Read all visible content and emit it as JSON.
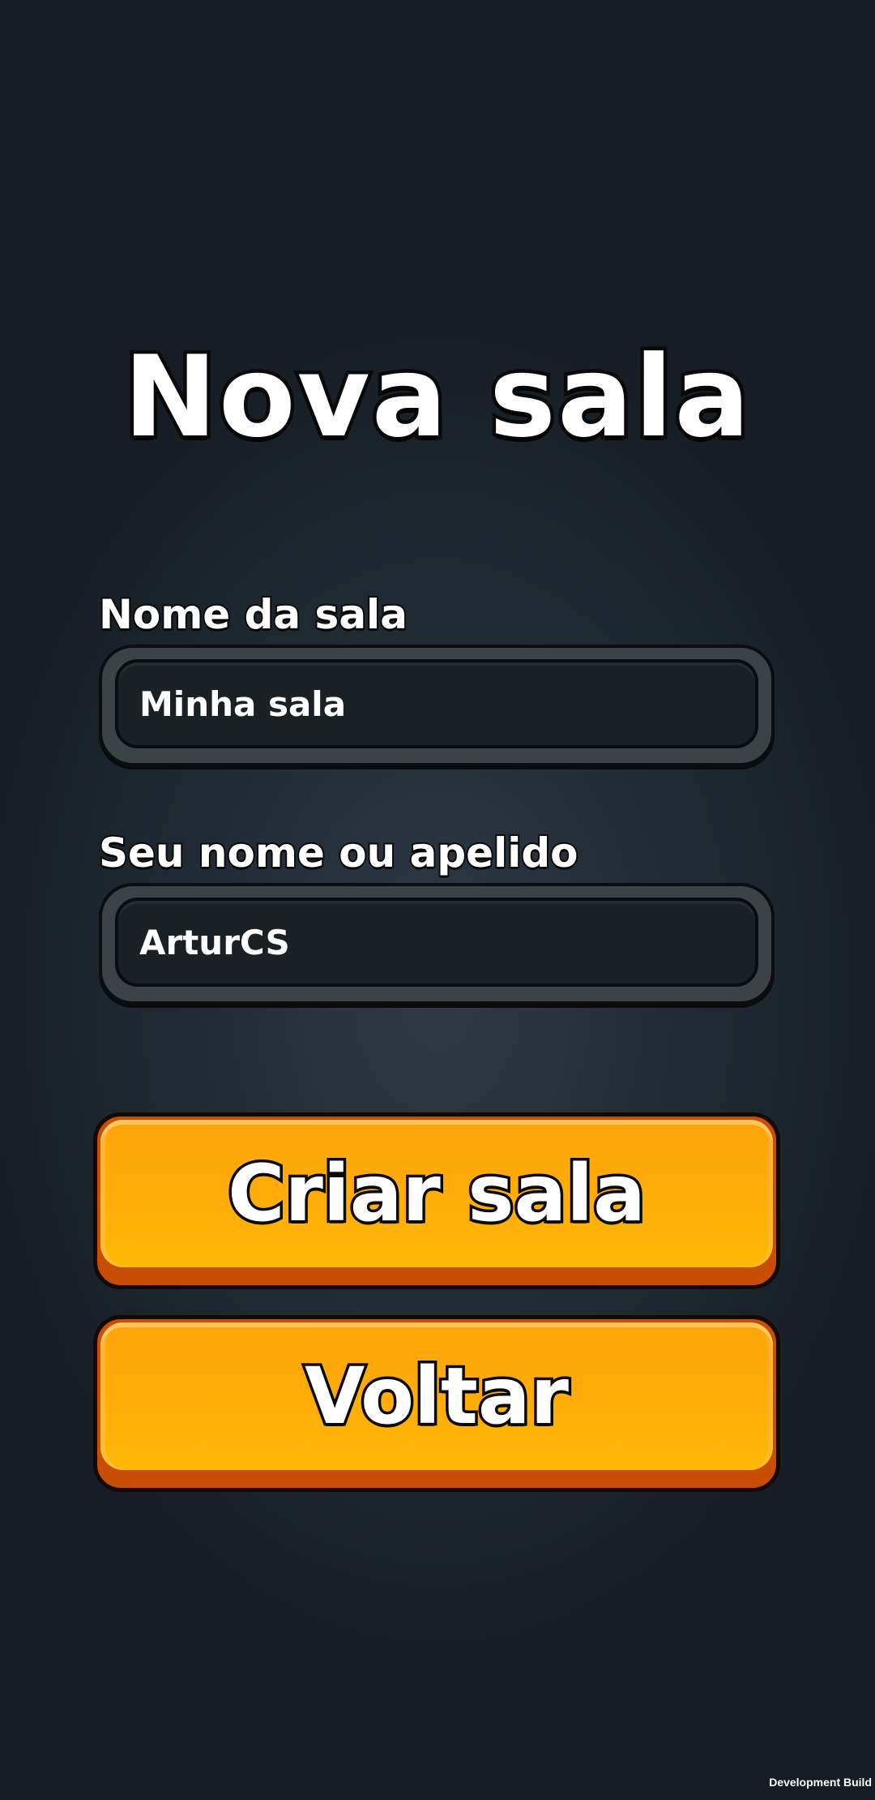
{
  "screen": {
    "title": "Nova sala",
    "accent_color": "#ffac08",
    "background_color": "#232c35"
  },
  "form": {
    "room_name": {
      "label": "Nome da sala",
      "value": "Minha sala"
    },
    "nickname": {
      "label": "Seu nome ou apelido",
      "value": "ArturCS"
    }
  },
  "actions": {
    "create_label": "Criar sala",
    "back_label": "Voltar"
  },
  "footer": {
    "build_text": "Development Build"
  }
}
